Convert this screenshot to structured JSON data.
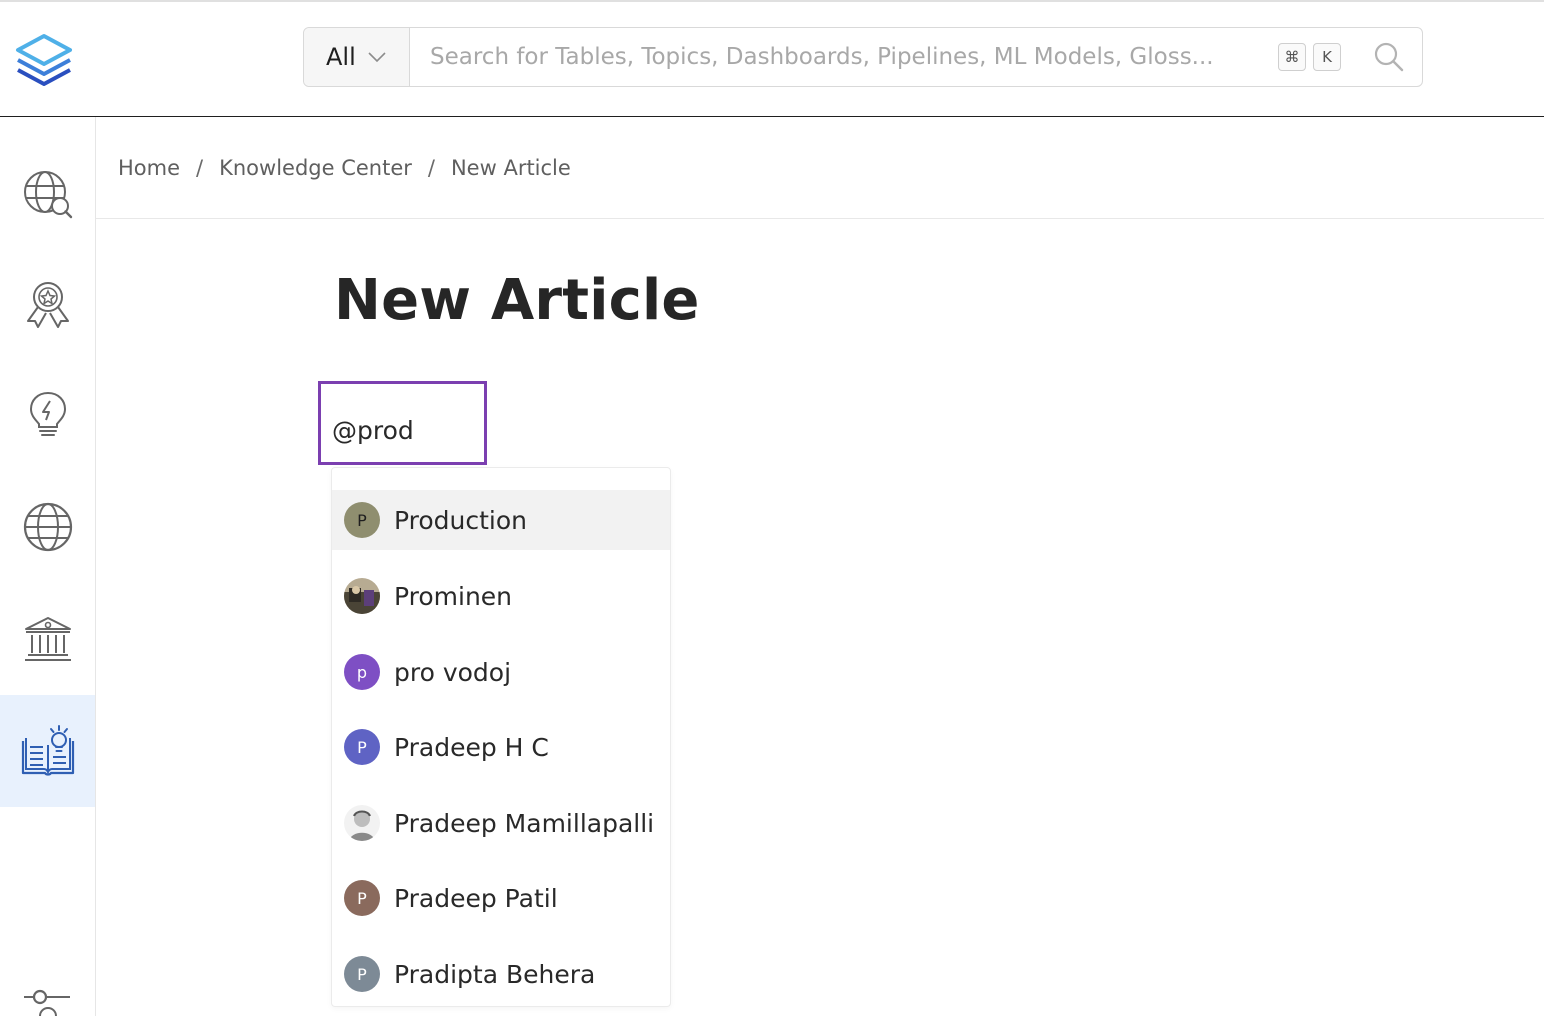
{
  "header": {
    "search": {
      "category": "All",
      "placeholder": "Search for Tables, Topics, Dashboards, Pipelines, ML Models, Gloss...",
      "shortcut_keys": [
        "⌘",
        "K"
      ]
    }
  },
  "sidebar": {
    "items": [
      {
        "name": "explore",
        "icon": "globe-search-icon"
      },
      {
        "name": "data-quality",
        "icon": "award-badge-icon"
      },
      {
        "name": "insights",
        "icon": "lightbulb-icon"
      },
      {
        "name": "domains",
        "icon": "globe-icon"
      },
      {
        "name": "governance",
        "icon": "bank-building-icon"
      },
      {
        "name": "knowledge-center",
        "icon": "book-idea-icon",
        "active": true
      },
      {
        "name": "settings",
        "icon": "slider-settings-icon"
      }
    ],
    "active_color": "#e8f1fd"
  },
  "breadcrumb": {
    "items": [
      "Home",
      "Knowledge Center",
      "New Article"
    ],
    "separator": "/"
  },
  "page": {
    "title": "New Article"
  },
  "editor": {
    "value": "@prod",
    "focus_color": "#7b3fb0"
  },
  "mentions": {
    "items": [
      {
        "name": "Production",
        "initial": "P",
        "color": "#8f8e6f",
        "selected": true
      },
      {
        "name": "Prominen",
        "initial": "",
        "color": "#6f6a5a",
        "photo": true
      },
      {
        "name": "pro vodoj",
        "initial": "p",
        "color": "#7e4fc4"
      },
      {
        "name": "Pradeep H C",
        "initial": "P",
        "color": "#5f63c4"
      },
      {
        "name": "Pradeep Mamillapalli",
        "initial": "",
        "color": "#d8d8d8",
        "photo": true
      },
      {
        "name": "Pradeep Patil",
        "initial": "P",
        "color": "#8a6a5d"
      },
      {
        "name": "Pradipta Behera",
        "initial": "P",
        "color": "#7d8a96"
      }
    ]
  }
}
